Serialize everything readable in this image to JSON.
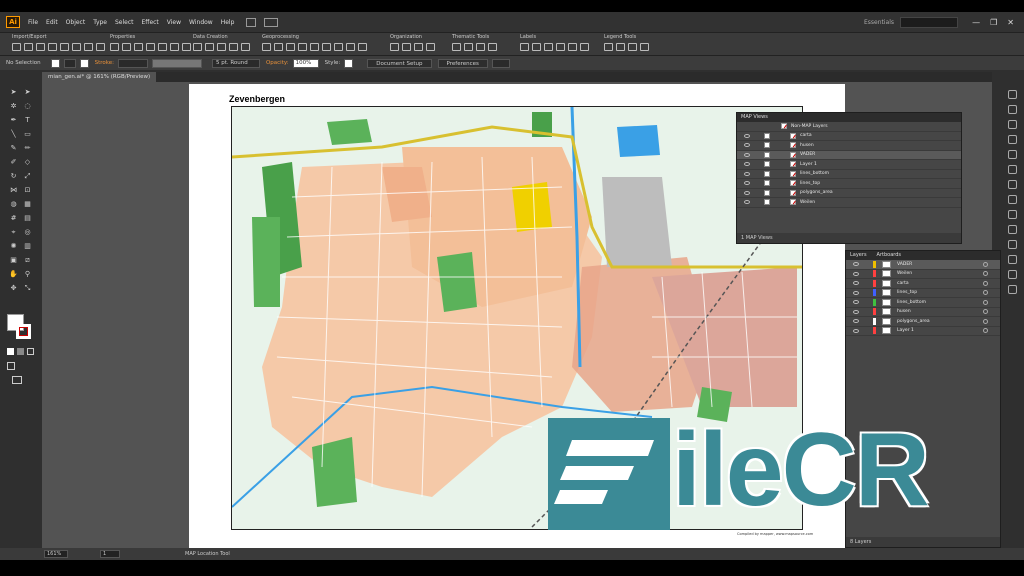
{
  "menubar": {
    "logo": "Ai",
    "items": [
      "File",
      "Edit",
      "Object",
      "Type",
      "Select",
      "Effect",
      "View",
      "Window",
      "Help"
    ],
    "workspace": "Essentials",
    "window_controls": [
      "—",
      "❐",
      "✕"
    ]
  },
  "toolsbar": {
    "groups": [
      "Import/Export",
      "Properties",
      "Data Creation",
      "Geoprocessing",
      "Organization",
      "Thematic Tools",
      "Labels",
      "Legend Tools"
    ]
  },
  "controlbar": {
    "selection": "No Selection",
    "stroke_label": "Stroke:",
    "stroke_preset": "5 pt. Round",
    "opacity_label": "Opacity:",
    "opacity_value": "100%",
    "style_label": "Style:",
    "document_setup": "Document Setup",
    "preferences": "Preferences"
  },
  "document": {
    "tab": "mian_gen.ai* @ 161% (RGB/Preview)",
    "map_title": "Zevenbergen",
    "map_credit": "Compiled by mapper, www.mapsource.com"
  },
  "mapviews": {
    "title": "MAP Views",
    "root_layer": "Non-MAP Layers",
    "layers": [
      "carta",
      "husen",
      "VADER",
      "Layer 1",
      "lines_bottom",
      "lines_top",
      "polygons_area",
      "Weilen"
    ],
    "footer": "1 MAP Views"
  },
  "layers": {
    "tabs": [
      "Layers",
      "Artboards"
    ],
    "items": [
      {
        "name": "VADER",
        "color": "#f0c000"
      },
      {
        "name": "Weilen",
        "color": "#ff4040"
      },
      {
        "name": "carta",
        "color": "#ff4040"
      },
      {
        "name": "lines_top",
        "color": "#4060ff"
      },
      {
        "name": "lines_bottom",
        "color": "#40c040"
      },
      {
        "name": "husen",
        "color": "#ff4040"
      },
      {
        "name": "polygons_area",
        "color": "#ffffff"
      },
      {
        "name": "Layer 1",
        "color": "#ff4040"
      }
    ],
    "footer": "8 Layers"
  },
  "statusbar": {
    "zoom": "161%",
    "artboard": "1",
    "tool": "MAP Location Tool"
  },
  "watermark": {
    "brand": "FileCR",
    "text": "ileCR"
  },
  "colors": {
    "accent": "#ff9a00",
    "watermark": "#3b8a96",
    "panel": "#464646"
  },
  "icons": [
    "selection-arrow-icon",
    "direct-selection-icon",
    "pen-icon",
    "type-icon",
    "line-icon",
    "rectangle-icon",
    "brush-icon",
    "pencil-icon",
    "rotate-icon",
    "scale-icon",
    "eyedropper-icon",
    "hand-icon",
    "zoom-icon",
    "eye-icon",
    "search-icon"
  ]
}
